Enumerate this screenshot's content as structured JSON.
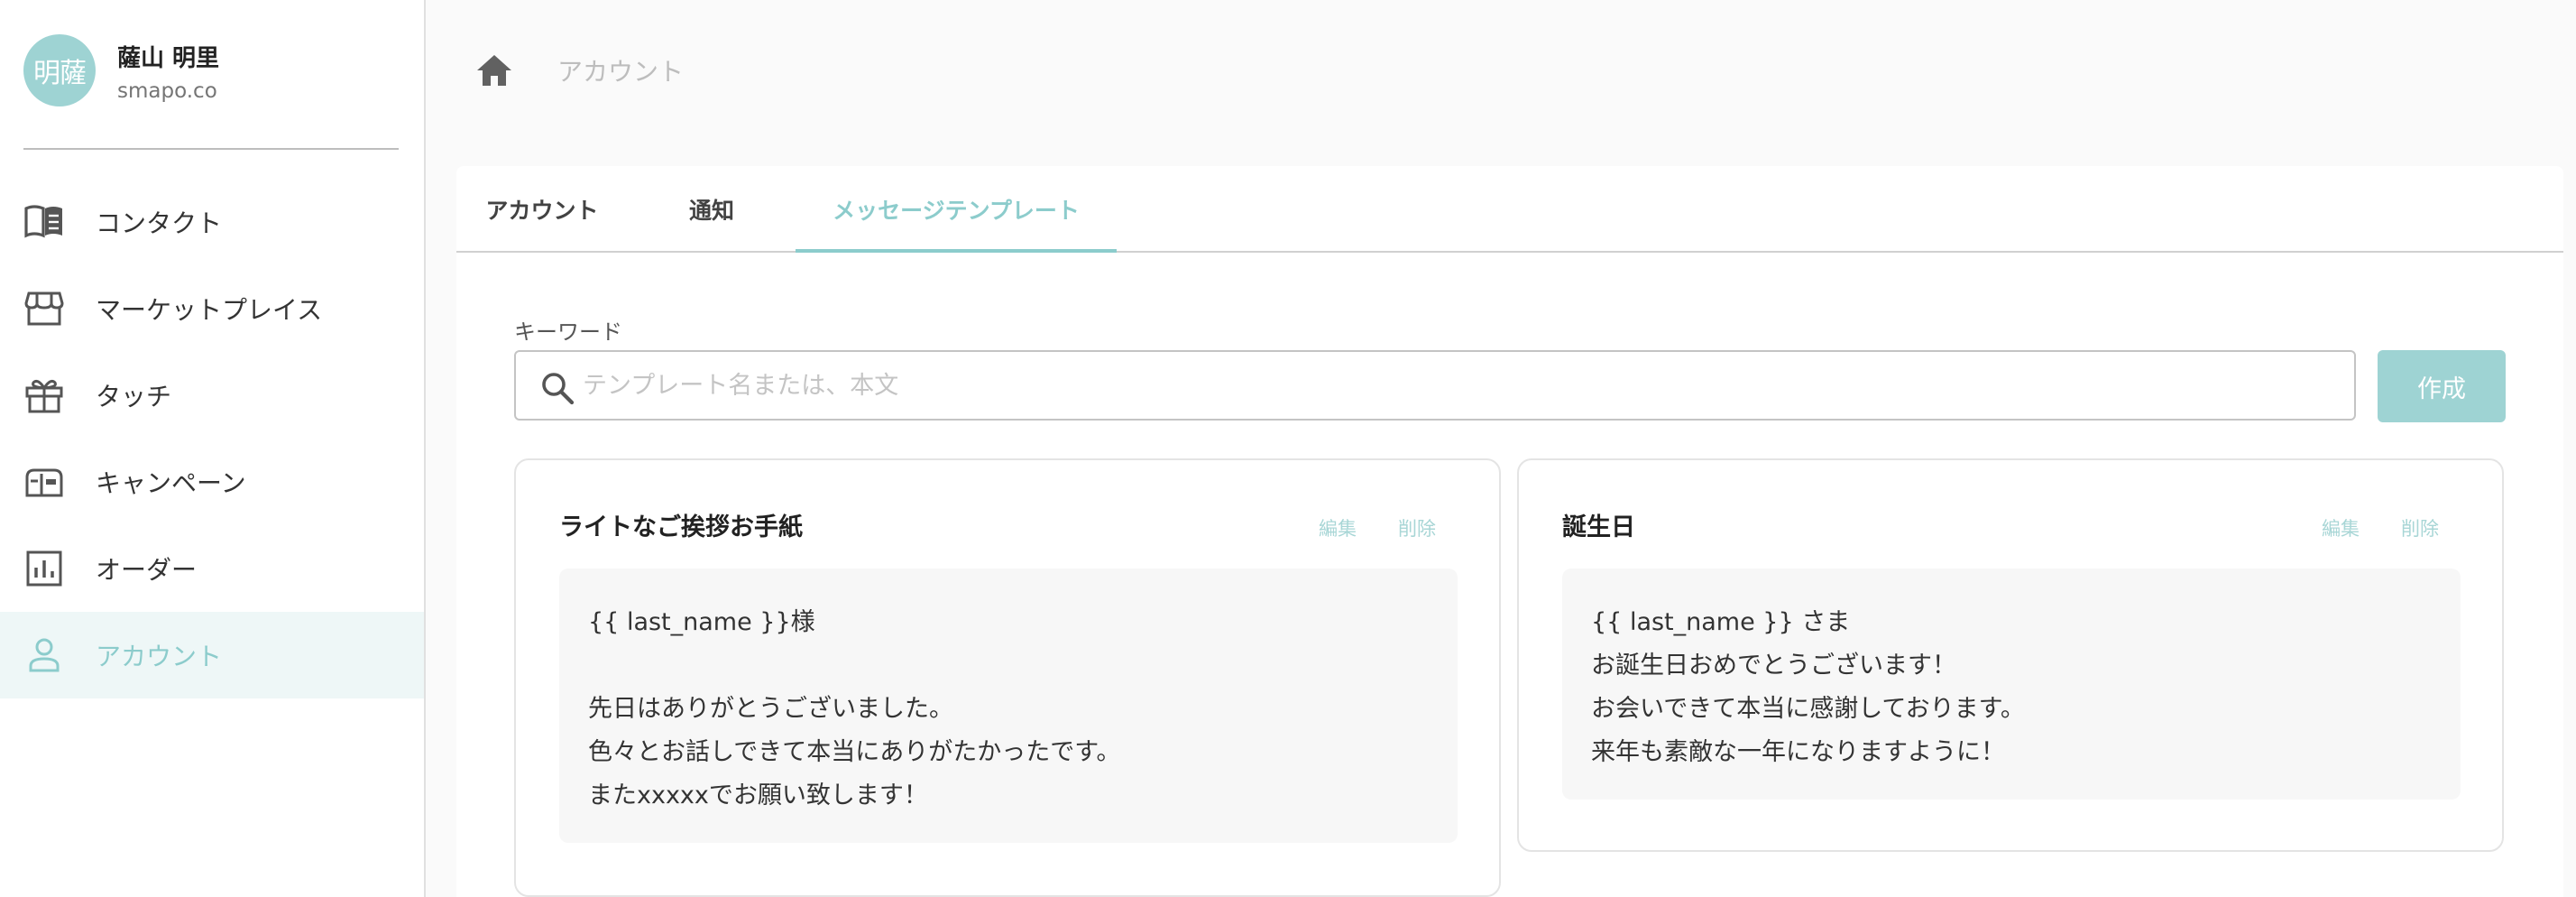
{
  "user": {
    "avatar_text": "明薩",
    "name": "薩山 明里",
    "domain": "smapo.co"
  },
  "sidebar": {
    "items": [
      {
        "label": "コンタクト",
        "icon": "book-icon"
      },
      {
        "label": "マーケットプレイス",
        "icon": "store-icon"
      },
      {
        "label": "タッチ",
        "icon": "gift-icon"
      },
      {
        "label": "キャンペーン",
        "icon": "mailbox-icon"
      },
      {
        "label": "オーダー",
        "icon": "bar-chart-icon"
      },
      {
        "label": "アカウント",
        "icon": "person-icon",
        "active": true
      }
    ]
  },
  "breadcrumb": {
    "current": "アカウント"
  },
  "tabs": [
    {
      "label": "アカウント"
    },
    {
      "label": "通知"
    },
    {
      "label": "メッセージテンプレート",
      "active": true
    }
  ],
  "search": {
    "label": "キーワード",
    "placeholder": "テンプレート名または、本文",
    "value": ""
  },
  "create_button": "作成",
  "templates": [
    {
      "title": "ライトなご挨拶お手紙",
      "edit_label": "編集",
      "delete_label": "削除",
      "body": [
        "{{ last_name }}様",
        "",
        "先日はありがとうございました。",
        "色々とお話しできて本当にありがたかったです。",
        "またxxxxxでお願い致します！"
      ]
    },
    {
      "title": "誕生日",
      "edit_label": "編集",
      "delete_label": "削除",
      "body": [
        "{{ last_name }} さま",
        "お誕生日おめでとうございます！",
        "お会いできて本当に感謝しております。",
        "来年も素敵な一年になりますように！"
      ]
    }
  ],
  "colors": {
    "accent": "#8ccccc",
    "accent_light": "#9ed3d3",
    "active_bg": "#eef7f7"
  }
}
